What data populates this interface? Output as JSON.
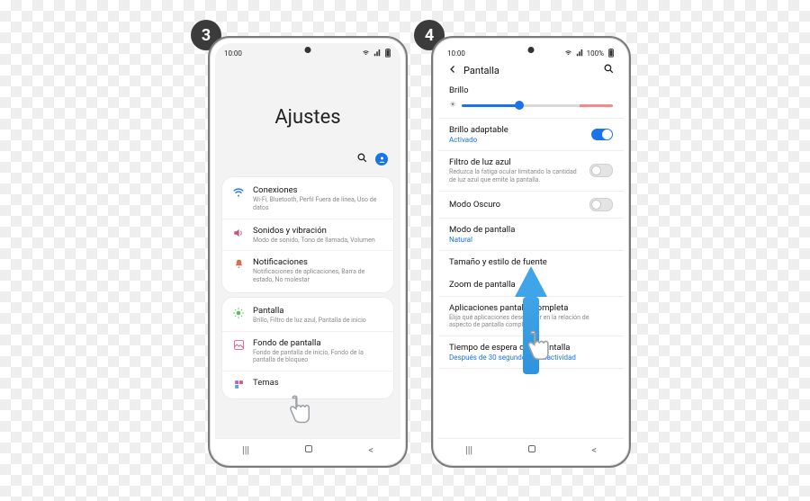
{
  "badges": {
    "step3": "3",
    "step4": "4"
  },
  "status": {
    "time": "10:00",
    "wifi": true,
    "signal": true,
    "battery": "100%"
  },
  "phone3": {
    "title": "Ajustes",
    "settings": [
      {
        "icon": "wifi",
        "title": "Conexiones",
        "sub": "Wi-Fi, Bluetooth, Perfil Fuera de línea, Uso de datos"
      },
      {
        "icon": "sound",
        "title": "Sonidos y vibración",
        "sub": "Modo de sonido, Tono de llamada, Volumen"
      },
      {
        "icon": "notif",
        "title": "Notificaciones",
        "sub": "Notificaciones de aplicaciones, Barra de estado, No molestar"
      }
    ],
    "settings2": [
      {
        "icon": "display",
        "title": "Pantalla",
        "sub": "Brillo, Filtro de luz azul, Pantalla de inicio"
      },
      {
        "icon": "wall",
        "title": "Fondo de pantalla",
        "sub": "Fondo de pantalla de inicio, Fondo de la pantalla de bloqueo"
      },
      {
        "icon": "themes",
        "title": "Temas",
        "sub": ""
      }
    ]
  },
  "phone4": {
    "header": "Pantalla",
    "brightness_label": "Brillo",
    "adaptive": {
      "title": "Brillo adaptable",
      "status": "Activado"
    },
    "bluelight": {
      "title": "Filtro de luz azul",
      "sub": "Reduzca la fatiga ocular limitando la cantidad de luz azul que emite la pantalla."
    },
    "darkmode": {
      "title": "Modo Oscuro"
    },
    "screenmode": {
      "title": "Modo de pantalla",
      "status": "Natural"
    },
    "fontsize": {
      "title": "Tamaño y estilo de fuente"
    },
    "zoom": {
      "title": "Zoom de pantalla"
    },
    "fullscreen": {
      "title": "Aplicaciones pantalla completa",
      "sub": "Elija qué aplicaciones desea usar en la relación de aspecto de pantalla completa."
    },
    "timeout": {
      "title": "Tiempo de espera de la pantalla",
      "status": "Después de 30 segundos de inactividad"
    }
  }
}
